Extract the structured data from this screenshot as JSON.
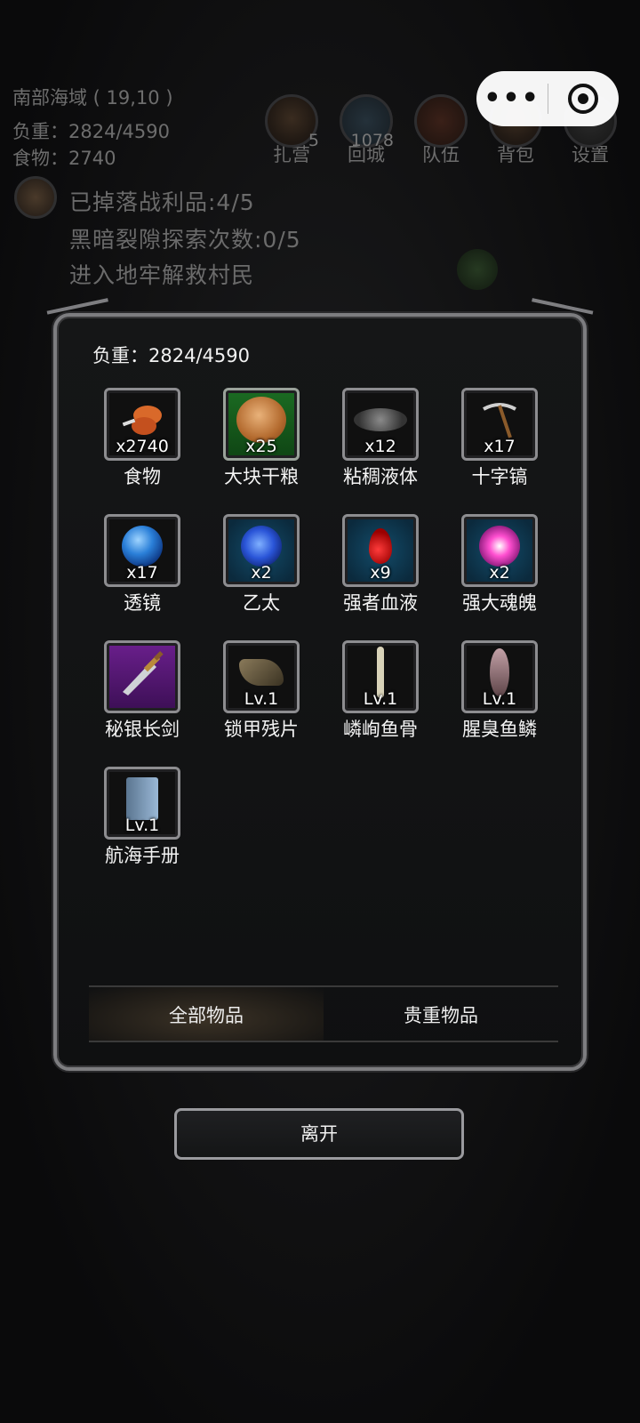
{
  "hud": {
    "location": "南部海域 ( 19,10 )",
    "weight": "负重：2824/4590",
    "food": "食物：2740",
    "buttons": [
      {
        "label": "扎营",
        "badge": "5",
        "icon": "campfire-icon"
      },
      {
        "label": "回城",
        "badge": "1078",
        "icon": "portal-icon"
      },
      {
        "label": "队伍",
        "badge": "",
        "icon": "team-icon"
      },
      {
        "label": "背包",
        "badge": "",
        "icon": "backpack-icon"
      },
      {
        "label": "设置",
        "badge": "",
        "icon": "gear-icon"
      }
    ],
    "quests": [
      "已掉落战利品:4/5",
      "黑暗裂隙探索次数:0/5",
      "进入地牢解救村民"
    ]
  },
  "capsule": {
    "more_icon": "•••",
    "close_icon": "target-icon"
  },
  "inventory": {
    "weight": "负重：2824/4590",
    "items": [
      {
        "name": "食物",
        "qty": "x2740",
        "icon": "meat-icon"
      },
      {
        "name": "大块干粮",
        "qty": "x25",
        "icon": "biscuit-icon"
      },
      {
        "name": "粘稠液体",
        "qty": "x12",
        "icon": "slime-icon"
      },
      {
        "name": "十字镐",
        "qty": "x17",
        "icon": "pickaxe-icon"
      },
      {
        "name": "透镜",
        "qty": "x17",
        "icon": "lens-icon"
      },
      {
        "name": "乙太",
        "qty": "x2",
        "icon": "ether-icon"
      },
      {
        "name": "强者血液",
        "qty": "x9",
        "icon": "blood-icon"
      },
      {
        "name": "强大魂魄",
        "qty": "x2",
        "icon": "soul-icon"
      },
      {
        "name": "秘银长剑",
        "qty": "",
        "icon": "sword-icon"
      },
      {
        "name": "锁甲残片",
        "qty": "Lv.1",
        "icon": "chainmail-icon"
      },
      {
        "name": "嶙峋鱼骨",
        "qty": "Lv.1",
        "icon": "fishbone-icon"
      },
      {
        "name": "腥臭鱼鳞",
        "qty": "Lv.1",
        "icon": "fishscale-icon"
      },
      {
        "name": "航海手册",
        "qty": "Lv.1",
        "icon": "book-icon"
      }
    ],
    "tabs": [
      "全部物品",
      "贵重物品"
    ],
    "active_tab": "全部物品"
  },
  "leave_label": "离开"
}
